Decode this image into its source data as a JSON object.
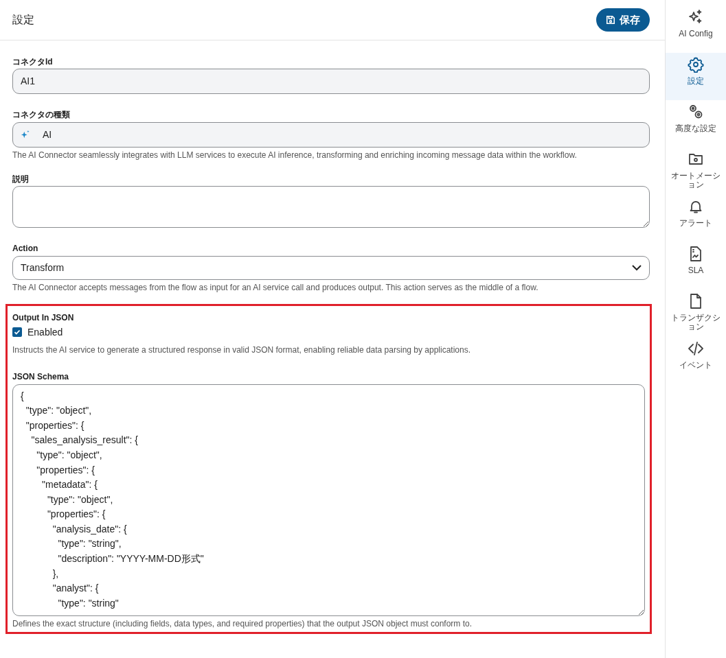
{
  "header": {
    "title": "設定",
    "save_button": "保存"
  },
  "fields": [
    {
      "kind": "text",
      "label": "コネクタId",
      "value": "AI1"
    },
    {
      "kind": "type",
      "label": "コネクタの種類",
      "value": "AI",
      "help": "The AI Connector seamlessly integrates with LLM services to execute AI inference, transforming and enriching incoming message data within the workflow."
    },
    {
      "kind": "textarea",
      "label": "説明"
    },
    {
      "kind": "select",
      "label": "Action",
      "value": "Transform",
      "help": "The AI Connector accepts messages from the flow as input for an AI service call and produces output. This action serves as the middle of a flow."
    }
  ],
  "highlighted_section": {
    "label": "Output In JSON",
    "checkbox": {
      "label": "Enabled",
      "checked": true
    },
    "help": "Instructs the AI service to generate a structured response in valid JSON format, enabling reliable data parsing by applications.",
    "schema_label": "JSON Schema",
    "schema_lines": [
      "{",
      "  \"type\": \"object\",",
      "  \"properties\": {",
      "    \"sales_analysis_result\": {",
      "      \"type\": \"object\",",
      "      \"properties\": {",
      "        \"metadata\": {",
      "          \"type\": \"object\",",
      "          \"properties\": {",
      "            \"analysis_date\": {",
      "              \"type\": \"string\",",
      "              \"description\": \"YYYY-MM-DD形式\"",
      "            },",
      "            \"analyst\": {",
      "              \"type\": \"string\""
    ],
    "schema_help": "Defines the exact structure (including fields, data types, and required properties) that the output JSON object must conform to."
  },
  "sidebar": {
    "items": [
      {
        "label": "AI Config",
        "selected": false
      },
      {
        "label": "設定",
        "selected": true
      },
      {
        "label": "高度な設定",
        "selected": false
      },
      {
        "label": "オートメーション",
        "selected": false
      },
      {
        "label": "アラート",
        "selected": false
      },
      {
        "label": "SLA",
        "selected": false
      },
      {
        "label": "トランザクション",
        "selected": false
      },
      {
        "label": "イベント",
        "selected": false
      }
    ]
  }
}
